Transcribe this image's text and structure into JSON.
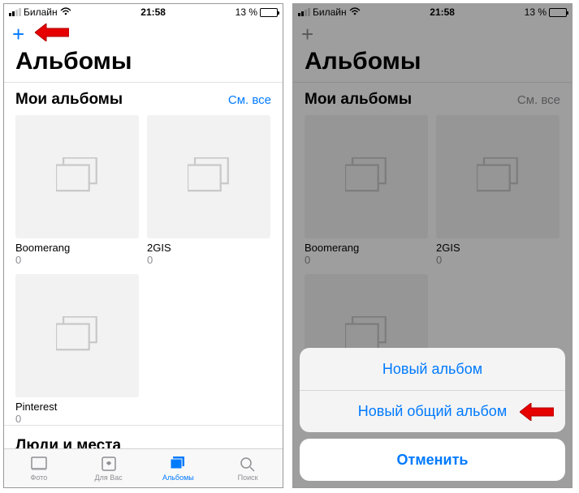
{
  "status": {
    "carrier": "Билайн",
    "time": "21:58",
    "battery_pct": "13 %"
  },
  "nav": {
    "title": "Альбомы"
  },
  "sections": {
    "my_albums": {
      "title": "Мои альбомы",
      "see_all": "См. все"
    },
    "people_places": {
      "title": "Люди и места"
    }
  },
  "albums": [
    {
      "name": "Boomerang",
      "count": "0"
    },
    {
      "name": "2GIS",
      "count": "0"
    },
    {
      "name": "Pinterest",
      "count": "0"
    }
  ],
  "tabs": [
    {
      "label": "Фото"
    },
    {
      "label": "Для Вас"
    },
    {
      "label": "Альбомы"
    },
    {
      "label": "Поиск"
    }
  ],
  "sheet": {
    "new_album": "Новый альбом",
    "new_shared_album": "Новый общий альбом",
    "cancel": "Отменить"
  }
}
